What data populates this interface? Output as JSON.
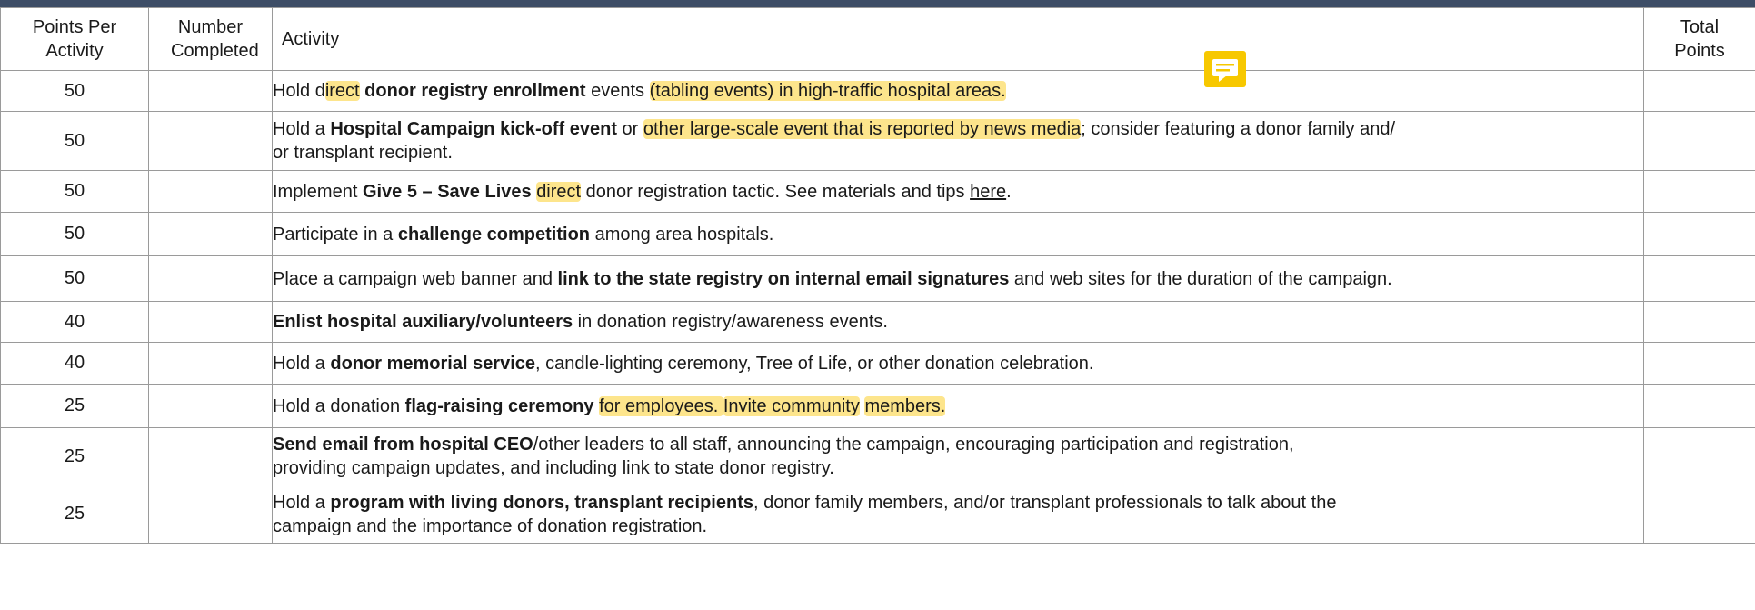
{
  "table": {
    "headers": {
      "points_per_activity": "Points Per Activity",
      "number_completed": "Number Completed",
      "activity": "Activity",
      "total_points": "Total Points"
    },
    "rows": [
      {
        "points": "50",
        "activity": [
          {
            "t": "Hold d"
          },
          {
            "t": "irect",
            "h": true
          },
          {
            "t": " "
          },
          {
            "t": "donor registry enrollment",
            "b": true
          },
          {
            "t": " events "
          },
          {
            "t": "(tabling events) in high-traffic hospital areas.",
            "h": true
          }
        ]
      },
      {
        "points": "50",
        "activity": [
          {
            "t": "Hold a "
          },
          {
            "t": "Hospital Campaign kick-off event",
            "b": true
          },
          {
            "t": " or "
          },
          {
            "t": "other large-scale event that is reported by news media",
            "h": true
          },
          {
            "t": "; consider featuring a donor family and/"
          },
          {
            "br": true
          },
          {
            "t": "or transplant recipient."
          }
        ]
      },
      {
        "points": "50",
        "activity": [
          {
            "t": "Implement "
          },
          {
            "t": "Give 5 – Save Lives",
            "b": true
          },
          {
            "t": " "
          },
          {
            "t": "direct",
            "h": true
          },
          {
            "t": " donor registration tactic. See materials and tips "
          },
          {
            "t": "here",
            "u": true
          },
          {
            "t": "."
          }
        ]
      },
      {
        "points": "50",
        "activity": [
          {
            "t": "Participate in a "
          },
          {
            "t": "challenge competition",
            "b": true
          },
          {
            "t": " among area hospitals."
          }
        ]
      },
      {
        "points": "50",
        "activity": [
          {
            "t": "Place a campaign web banner and "
          },
          {
            "t": "link to the state registry on internal email signatures",
            "b": true
          },
          {
            "t": " and web sites for the duration of the campaign."
          }
        ]
      },
      {
        "points": "40",
        "activity": [
          {
            "t": "Enlist hospital auxiliary/volunteers",
            "b": true
          },
          {
            "t": " in donation registry/awareness events."
          }
        ]
      },
      {
        "points": "40",
        "activity": [
          {
            "t": "Hold a "
          },
          {
            "t": "donor memorial service",
            "b": true
          },
          {
            "t": ", candle-lighting ceremony, Tree of Life, or other donation celebration."
          }
        ]
      },
      {
        "points": "25",
        "activity": [
          {
            "t": "Hold a donation "
          },
          {
            "t": "flag-raising ceremony",
            "b": true
          },
          {
            "t": " "
          },
          {
            "t": "for employees. ",
            "h": true
          },
          {
            "t": "Invite community",
            "h": true
          },
          {
            "t": " "
          },
          {
            "t": "members.",
            "h": true
          }
        ]
      },
      {
        "points": "25",
        "activity": [
          {
            "t": "Send email from hospital CEO",
            "b": true
          },
          {
            "t": "/other leaders to all staff, announcing the campaign, encouraging participation and registration,"
          },
          {
            "br": true
          },
          {
            "t": "providing campaign updates, and including link to state donor registry."
          }
        ]
      },
      {
        "points": "25",
        "activity": [
          {
            "t": "Hold a "
          },
          {
            "t": "program with living donors, transplant recipients",
            "b": true
          },
          {
            "t": ", donor family members, and/or transplant professionals to talk about the"
          },
          {
            "br": true
          },
          {
            "t": "campaign and the importance of donation registration."
          }
        ]
      }
    ]
  },
  "colors": {
    "header_bar": "#3d4d66",
    "highlight": "#fde58c",
    "comment_icon": "#f7c800",
    "border": "#9a9a9a"
  },
  "icons": {
    "comment": "comment-icon"
  }
}
